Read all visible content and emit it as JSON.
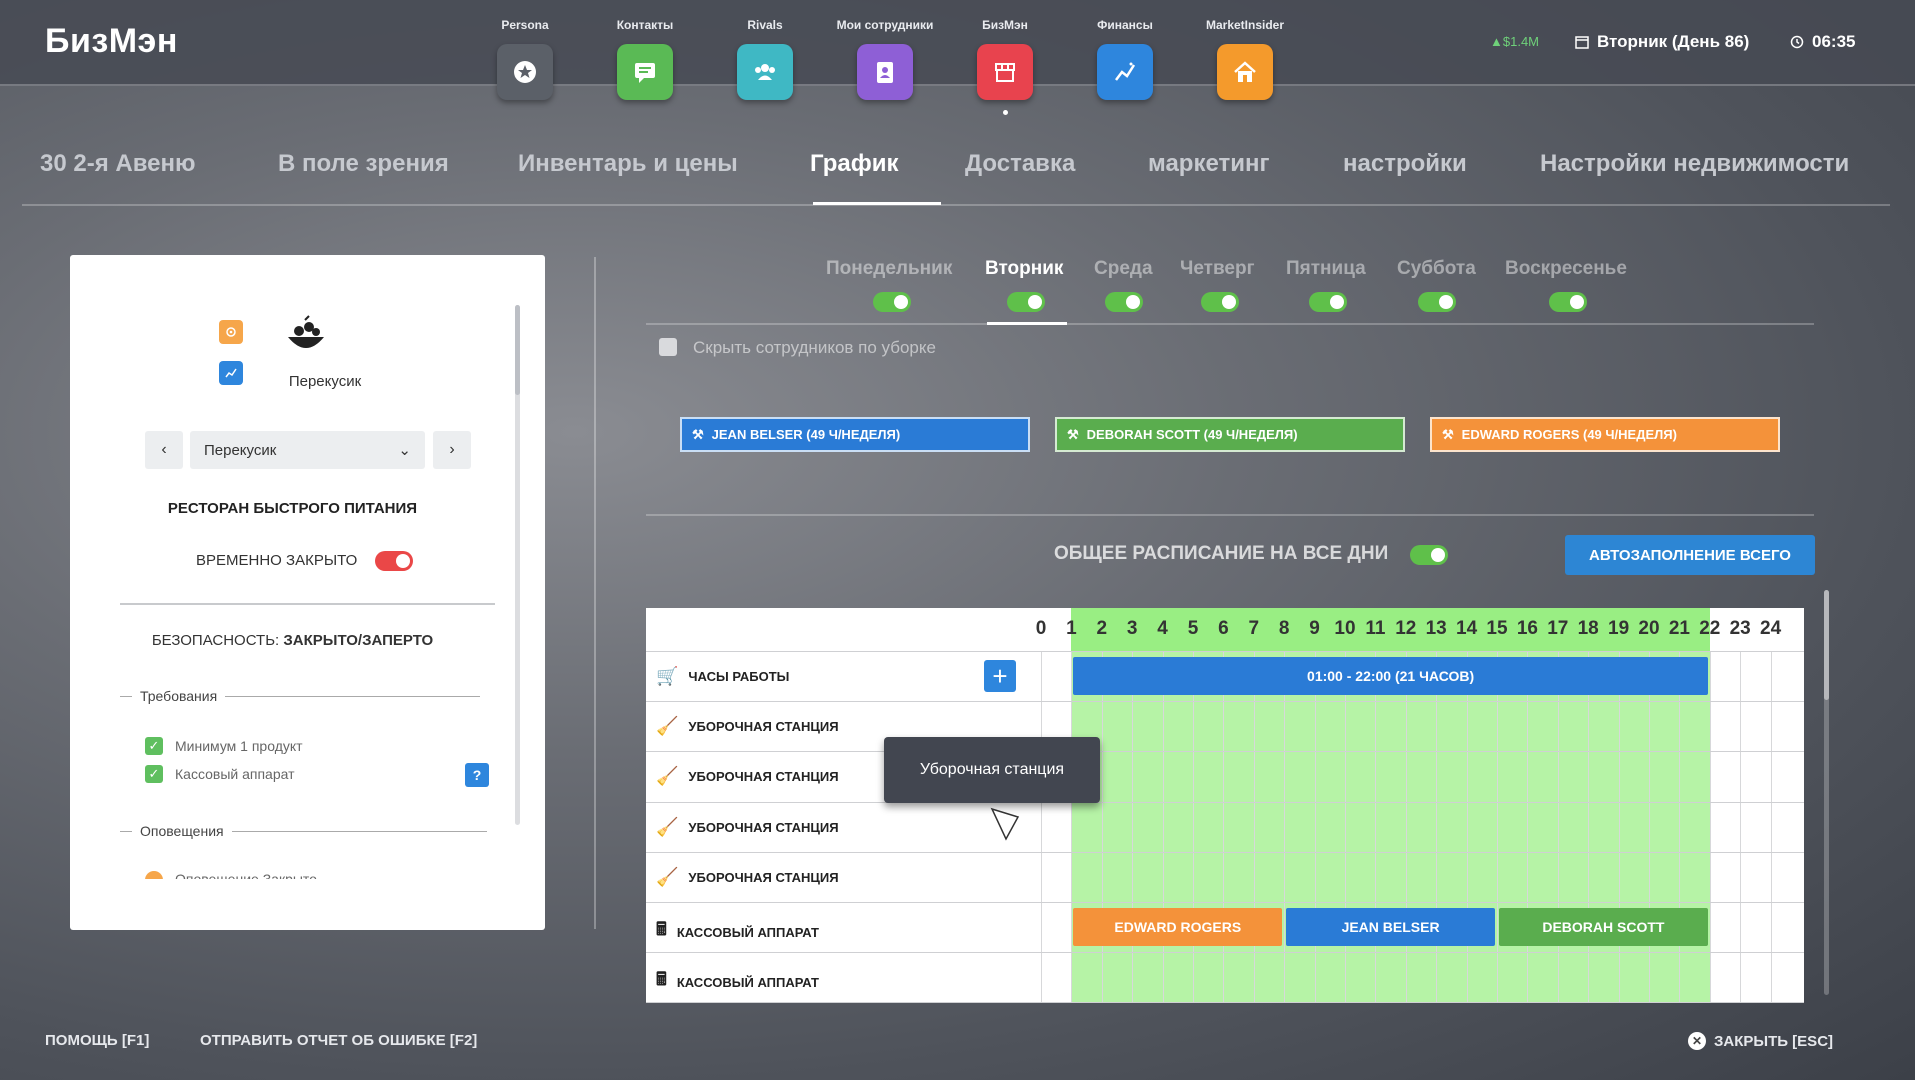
{
  "topbar": {
    "brand": "БизМэн",
    "apps": [
      {
        "label": "Persona",
        "icon": "star-badge-icon",
        "color": "#5b6068"
      },
      {
        "label": "Контакты",
        "icon": "chat-icon",
        "color": "#5aba55"
      },
      {
        "label": "Rivals",
        "icon": "people-icon",
        "color": "#3fb8c4"
      },
      {
        "label": "Мои сотрудники",
        "icon": "employee-badge-icon",
        "color": "#8e5fd6"
      },
      {
        "label": "БизМэн",
        "icon": "store-icon",
        "color": "#e8434e"
      },
      {
        "label": "Финансы",
        "icon": "chart-icon",
        "color": "#2e86dd"
      },
      {
        "label": "MarketInsider",
        "icon": "house-icon",
        "color": "#f49a2c"
      }
    ],
    "money": "▲$1.4M",
    "day": "Вторник (День 86)",
    "time": "06:35"
  },
  "tabs": [
    "30 2-я Авеню",
    "В поле зрения",
    "Инвентарь и цены",
    "График",
    "Доставка",
    "маркетинг",
    "настройки",
    "Настройки недвижимости"
  ],
  "active_tab": "График",
  "business": {
    "name": "Перекусик",
    "dropdown_value": "Перекусик",
    "type": "РЕСТОРАН БЫСТРОГО ПИТАНИЯ",
    "temp_closed_label": "ВРЕМЕННО ЗАКРЫТО",
    "security_label": "БЕЗОПАСНОСТЬ:",
    "security_value": "ЗАКРЫТО/ЗАПЕРТО",
    "requirements_title": "Требования",
    "requirements": [
      "Минимум 1 продукт",
      "Кассовый аппарат"
    ],
    "help_label": "?",
    "notifications_title": "Оповещения",
    "notification_partial": "Оповещение Закрыто"
  },
  "days": [
    "Понедельник",
    "Вторник",
    "Среда",
    "Четверг",
    "Пятница",
    "Суббота",
    "Воскресенье"
  ],
  "active_day": "Вторник",
  "hide_cleaners_label": "Скрыть сотрудников по уборке",
  "employees": [
    {
      "label": "JEAN BELSER (49 Ч/НЕДЕЛЯ)",
      "color": "#2a7bd6"
    },
    {
      "label": "DEBORAH SCOTT (49 Ч/НЕДЕЛЯ)",
      "color": "#5aad4e"
    },
    {
      "label": "EDWARD ROGERS (49 Ч/НЕДЕЛЯ)",
      "color": "#f4923a"
    }
  ],
  "shared_schedule_label": "ОБЩЕЕ РАСПИСАНИЕ НА ВСЕ ДНИ",
  "autofill_label": "АВТОЗАПОЛНЕНИЕ ВСЕГО",
  "hours": [
    "0",
    "1",
    "2",
    "3",
    "4",
    "5",
    "6",
    "7",
    "8",
    "9",
    "10",
    "11",
    "12",
    "13",
    "14",
    "15",
    "16",
    "17",
    "18",
    "19",
    "20",
    "21",
    "22",
    "23",
    "24"
  ],
  "open_hours": {
    "start": 1,
    "end": 22
  },
  "rows": [
    {
      "label": "ЧАСЫ РАБОТЫ",
      "icon": "cart-icon"
    },
    {
      "label": "УБОРОЧНАЯ СТАНЦИЯ",
      "icon": "broom-icon"
    },
    {
      "label": "УБОРОЧНАЯ СТАНЦИЯ",
      "icon": "broom-icon"
    },
    {
      "label": "УБОРОЧНАЯ СТАНЦИЯ",
      "icon": "broom-icon"
    },
    {
      "label": "УБОРОЧНАЯ СТАНЦИЯ",
      "icon": "broom-icon"
    },
    {
      "label": "КАССОВЫЙ АППАРАТ",
      "icon": "register-icon"
    },
    {
      "label": "КАССОВЫЙ АППАРАТ",
      "icon": "register-icon"
    }
  ],
  "hours_bar": {
    "label": "01:00 - 22:00 (21 ЧАСОВ)",
    "start": 1,
    "end": 22
  },
  "shifts": [
    {
      "name": "EDWARD ROGERS",
      "start": 1,
      "end": 8,
      "color": "#f4923a"
    },
    {
      "name": "JEAN BELSER",
      "start": 8,
      "end": 15,
      "color": "#2a7bd6"
    },
    {
      "name": "DEBORAH SCOTT",
      "start": 15,
      "end": 22,
      "color": "#5aad4e"
    }
  ],
  "tooltip": "Уборочная станция",
  "footer": {
    "help": "ПОМОЩЬ [F1]",
    "report": "ОТПРАВИТЬ ОТЧЕТ ОБ ОШИБКЕ [F2]",
    "close": "ЗАКРЫТЬ [ESC]"
  }
}
